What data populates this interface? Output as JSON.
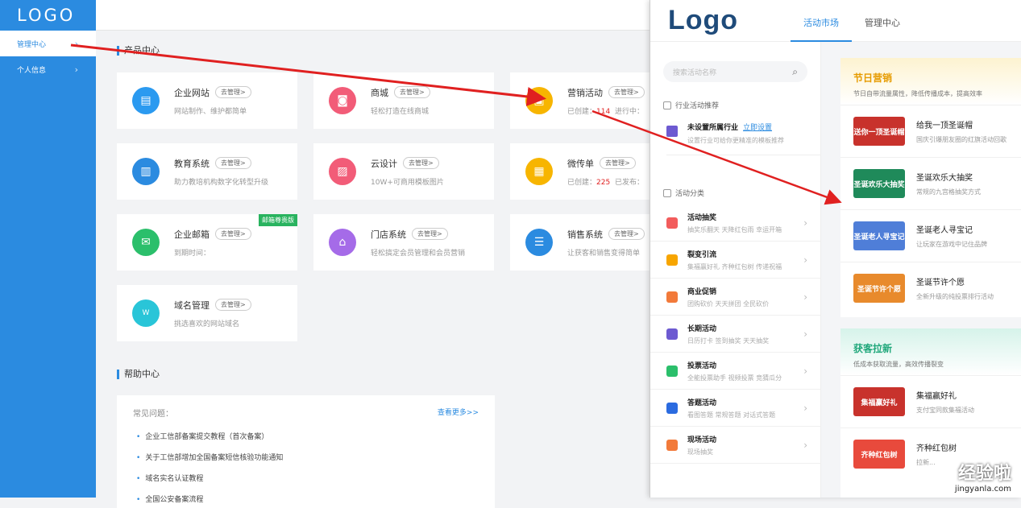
{
  "sidebar": {
    "logo": "LOGO",
    "items": [
      {
        "label": "管理中心"
      },
      {
        "label": "个人信息"
      }
    ]
  },
  "main": {
    "product_title": "产品中心",
    "manage_label": "去管理>",
    "cards": [
      {
        "name": "企业网站",
        "desc": "网站制作、维护都简单",
        "color": "#2b9af0"
      },
      {
        "name": "商城",
        "desc": "轻松打造在线商城",
        "color": "#f25c78"
      },
      {
        "name": "营销活动",
        "created_label": "已创建：",
        "created": "114",
        "ongoing": "进行中：",
        "color": "#f7b500"
      },
      {
        "name": "教育系统",
        "desc": "助力教培机构数字化转型升级",
        "color": "#2b8be0"
      },
      {
        "name": "云设计",
        "desc": "10W+可商用模板图片",
        "color": "#f25c78"
      },
      {
        "name": "微传单",
        "created_label": "已创建：",
        "created": "225",
        "published": "已发布：",
        "color": "#f7b500"
      },
      {
        "name": "企业邮箱",
        "desc": "到期时间：",
        "badge": "邮箱尊贵版",
        "color": "#2bbf6b"
      },
      {
        "name": "门店系统",
        "desc": "轻松搞定会员管理和会员营销",
        "color": "#a56be8"
      },
      {
        "name": "销售系统",
        "desc": "让获客和销售变得简单",
        "color": "#2b8be0"
      },
      {
        "name": "域名管理",
        "desc": "挑选喜欢的网站域名",
        "color": "#29c5d8"
      }
    ],
    "help_title": "帮助中心",
    "help": {
      "heading": "常见问题：",
      "more": "查看更多>>",
      "items": [
        "企业工信部备案提交教程（首次备案）",
        "关于工信部增加全国备案短信核验功能通知",
        "域名实名认证教程",
        "全国公安备案流程"
      ]
    }
  },
  "overlay": {
    "logo": "Logo",
    "tabs": [
      {
        "label": "活动市场"
      },
      {
        "label": "管理中心"
      }
    ],
    "search_placeholder": "搜索活动名称",
    "recommend_title": "行业活动推荐",
    "industry": {
      "title": "未设置所属行业",
      "link": "立即设置",
      "desc": "设置行业可给你更精准的模板推荐"
    },
    "category_title": "活动分类",
    "categories": [
      {
        "name": "活动抽奖",
        "desc": "抽奖乐翻天   天降红包雨   幸运开箱",
        "color": "#f25c5c"
      },
      {
        "name": "裂变引流",
        "desc": "集福赢好礼   齐种红包树   传递祝福",
        "color": "#f7a500"
      },
      {
        "name": "商业促销",
        "desc": "团购砍价   天天拼团   全民砍价",
        "color": "#f27a3a"
      },
      {
        "name": "长期活动",
        "desc": "日历打卡   签到抽奖   天天抽奖",
        "color": "#6d5ad1"
      },
      {
        "name": "投票活动",
        "desc": "全能投票助手   视频投票   竞猜瓜分",
        "color": "#2bbf6b"
      },
      {
        "name": "答题活动",
        "desc": "看图答题   常规答题   对话式答题",
        "color": "#2b6be0"
      },
      {
        "name": "现场活动",
        "desc": "现场抽奖",
        "color": "#f27a3a"
      }
    ],
    "festival": {
      "title": "节日营销",
      "subtitle": "节日自带流量属性，降低传播成本，提高效率",
      "items": [
        {
          "title": "给我一顶圣诞帽",
          "desc": "国庆引爆朋友圈的红旗活动回歌",
          "thumb": "送你一顶圣诞帽",
          "color": "#c8322c"
        },
        {
          "title": "圣诞欢乐大抽奖",
          "desc": "常规的九宫格抽奖方式",
          "thumb": "圣诞欢乐大抽奖",
          "color": "#1f8a5a"
        },
        {
          "title": "圣诞老人寻宝记",
          "desc": "让玩家在游戏中记住品牌",
          "thumb": "圣诞老人寻宝记",
          "color": "#4f7ed8"
        },
        {
          "title": "圣诞节许个愿",
          "desc": "全新升级的纯投票排行活动",
          "thumb": "圣诞节许个愿",
          "color": "#e88a2c"
        }
      ]
    },
    "acquire": {
      "title": "获客拉新",
      "subtitle": "低成本获取流量，高效传播裂变",
      "items": [
        {
          "title": "集福赢好礼",
          "desc": "支付宝同款集福活动",
          "thumb": "集福赢好礼",
          "color": "#c8322c"
        },
        {
          "title": "齐种红包树",
          "desc": "拉新...",
          "thumb": "齐种红包树",
          "color": "#e84a3c"
        }
      ]
    }
  },
  "watermark": {
    "main": "经验啦",
    "site": "jingyanla.com"
  }
}
